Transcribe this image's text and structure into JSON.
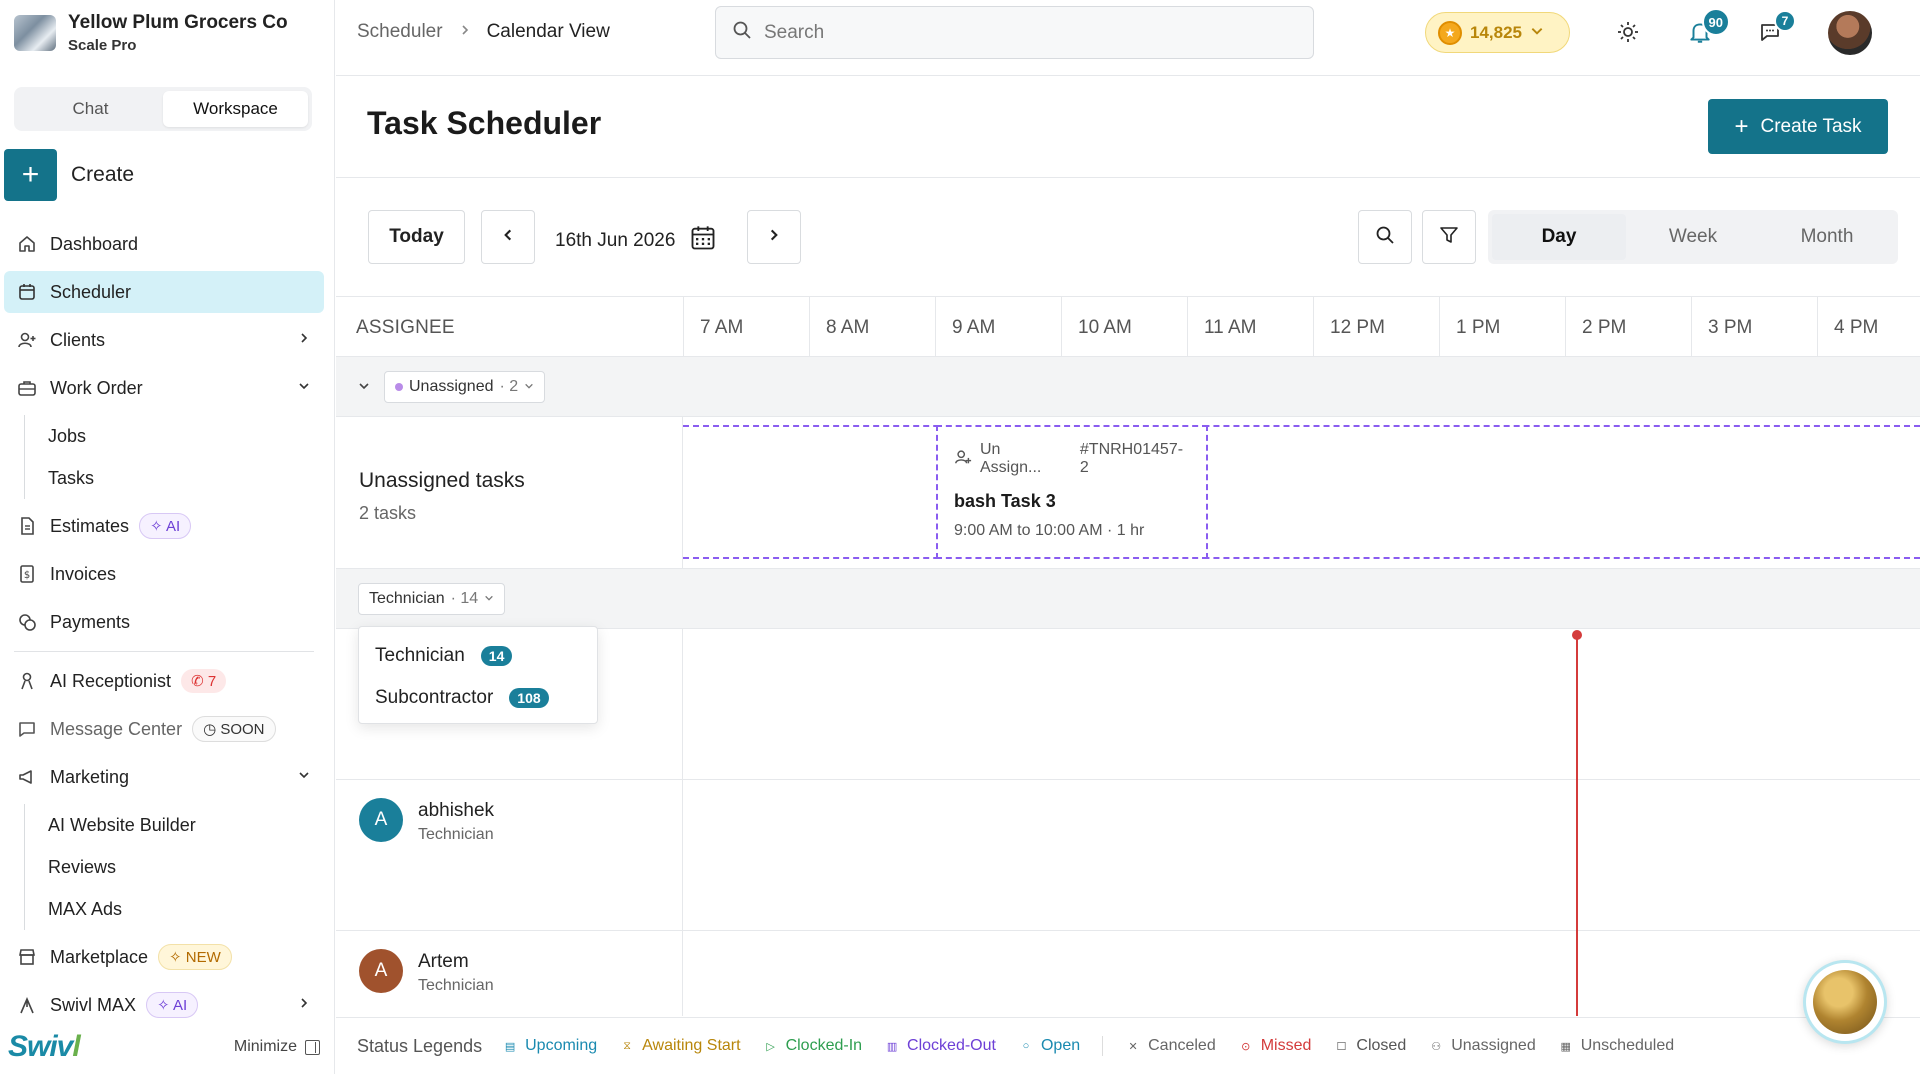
{
  "org": {
    "name": "Yellow Plum Grocers Co",
    "plan": "Scale Pro"
  },
  "mode_tabs": {
    "chat": "Chat",
    "workspace": "Workspace"
  },
  "create_label": "Create",
  "nav": {
    "dashboard": "Dashboard",
    "scheduler": "Scheduler",
    "clients": "Clients",
    "work_order": "Work Order",
    "jobs": "Jobs",
    "tasks": "Tasks",
    "estimates": "Estimates",
    "estimates_badge": "AI",
    "invoices": "Invoices",
    "payments": "Payments",
    "ai_receptionist": "AI Receptionist",
    "ai_receptionist_badge": "7",
    "message_center": "Message Center",
    "message_center_badge": "SOON",
    "marketing": "Marketing",
    "ai_website_builder": "AI Website Builder",
    "reviews": "Reviews",
    "max_ads": "MAX Ads",
    "marketplace": "Marketplace",
    "marketplace_badge": "NEW",
    "swivl_max": "Swivl MAX",
    "swivl_max_badge": "AI"
  },
  "footer": {
    "brand_a": "Swiv",
    "brand_b": "l",
    "minimize": "Minimize"
  },
  "breadcrumb": {
    "parent": "Scheduler",
    "current": "Calendar View"
  },
  "search": {
    "placeholder": "Search"
  },
  "coins": "14,825",
  "notifications_count": "90",
  "messages_count": "7",
  "page_title": "Task Scheduler",
  "create_task": "Create Task",
  "controls": {
    "today": "Today",
    "date": "16th Jun 2026"
  },
  "views": {
    "day": "Day",
    "week": "Week",
    "month": "Month",
    "active": "Day"
  },
  "grid": {
    "assignee_header": "ASSIGNEE",
    "hours": [
      "7 AM",
      "8 AM",
      "9 AM",
      "10 AM",
      "11 AM",
      "12 PM",
      "1 PM",
      "2 PM",
      "3 PM",
      "4 PM"
    ],
    "unassigned_chip": "Unassigned",
    "unassigned_count": "· 2",
    "unassigned_title": "Unassigned tasks",
    "unassigned_sub": "2 tasks",
    "task": {
      "assignee": "Un Assign...",
      "id": "#TNRH01457-2",
      "name": "bash Task 3",
      "time": "9:00 AM to 10:00 AM · 1 hr"
    },
    "tech_chip": "Technician",
    "tech_count": "· 14",
    "dropdown": [
      {
        "label": "Technician",
        "count": "14"
      },
      {
        "label": "Subcontractor",
        "count": "108"
      }
    ],
    "people": [
      {
        "initial": "A",
        "name": "abhishek",
        "role": "Technician",
        "color": "#1a7f9a"
      },
      {
        "initial": "A",
        "name": "Artem",
        "role": "Technician",
        "color": "#a0522d"
      }
    ]
  },
  "legend": {
    "title": "Status Legends",
    "items": [
      {
        "label": "Upcoming",
        "color": "#1a8ab0"
      },
      {
        "label": "Awaiting Start",
        "color": "#b8860b"
      },
      {
        "label": "Clocked-In",
        "color": "#2e9e4f"
      },
      {
        "label": "Clocked-Out",
        "color": "#6d3fd6"
      },
      {
        "label": "Open",
        "color": "#1a8ab0"
      },
      {
        "label": "Canceled",
        "color": "#666666"
      },
      {
        "label": "Missed",
        "color": "#d33b3b"
      },
      {
        "label": "Closed",
        "color": "#555555"
      },
      {
        "label": "Unassigned",
        "color": "#666666"
      },
      {
        "label": "Unscheduled",
        "color": "#666666"
      }
    ]
  },
  "colors": {
    "accent": "#14738a",
    "active_nav": "#d4f1f8",
    "now_line": "#d43b3b",
    "task_border": "#8a5cf0"
  }
}
